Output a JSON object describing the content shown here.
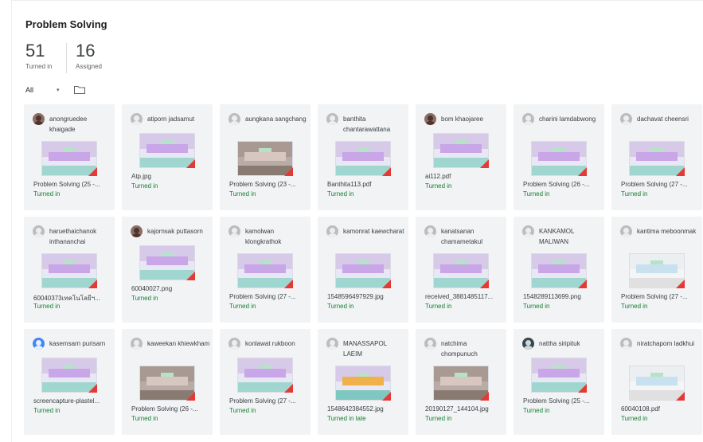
{
  "assignment": {
    "title": "Problem Solving"
  },
  "stats": {
    "turned_in_count": "51",
    "turned_in_label": "Turned in",
    "assigned_count": "16",
    "assigned_label": "Assigned"
  },
  "filter": {
    "selected": "All",
    "caret": "▾"
  },
  "icons": {
    "folder": "folder-icon",
    "avatar": "avatar-icon",
    "pdf": "pdf-badge"
  },
  "students": [
    {
      "name": "anongruedee khaigade",
      "file": "Problem Solving (25 -...",
      "status": "Turned in"
    },
    {
      "name": "atiporn jadsamut",
      "file": "Atp.jpg",
      "status": "Turned in"
    },
    {
      "name": "aungkana sangchang",
      "file": "Problem Solving (23 -...",
      "status": "Turned in"
    },
    {
      "name": "banthita chantarawattana",
      "file": "Banthita113.pdf",
      "status": "Turned in"
    },
    {
      "name": "bom khaojaree",
      "file": "ai112.pdf",
      "status": "Turned in"
    },
    {
      "name": "charini lamdabwong",
      "file": "Problem Solving (26 -...",
      "status": "Turned in"
    },
    {
      "name": "dachavat cheensri",
      "file": "Problem Solving (27 -...",
      "status": "Turned in"
    },
    {
      "name": "haruethaichanok inthananchai",
      "file": "60040373เทคโนโลยีฯ...",
      "status": "Turned in"
    },
    {
      "name": "kajornsak puttasorn",
      "file": "60040027.png",
      "status": "Turned in"
    },
    {
      "name": "kamolwan klongkrathok",
      "file": "Problem Solving (27 -...",
      "status": "Turned in"
    },
    {
      "name": "kamonrat kaewcharat",
      "file": "1548596497929.jpg",
      "status": "Turned in"
    },
    {
      "name": "kanatsanan chamametakul",
      "file": "received_3881485117...",
      "status": "Turned in"
    },
    {
      "name": "KANKAMOL MALIWAN",
      "file": "1548289113699.png",
      "status": "Turned in"
    },
    {
      "name": "kantima meboonmak",
      "file": "Problem Solving (27 -...",
      "status": "Turned in"
    },
    {
      "name": "kasemsarn purisarn",
      "file": "screencapture-plastel...",
      "status": "Turned in"
    },
    {
      "name": "kaweekan khiewkham",
      "file": "Problem Solving (26 -...",
      "status": "Turned in"
    },
    {
      "name": "konlawat rukboon",
      "file": "Problem Solving (27 -...",
      "status": "Turned in"
    },
    {
      "name": "MANASSAPOL LAEIM",
      "file": "1548642384552.jpg",
      "status": "Turned in late"
    },
    {
      "name": "natchima chompunuch",
      "file": "20190127_144104.jpg",
      "status": "Turned in"
    },
    {
      "name": "nattha siripituk",
      "file": "Problem Solving (25 -...",
      "status": "Turned in"
    },
    {
      "name": "niratchaporn ladkhui",
      "file": "60040108.pdf",
      "status": "Turned in"
    }
  ]
}
